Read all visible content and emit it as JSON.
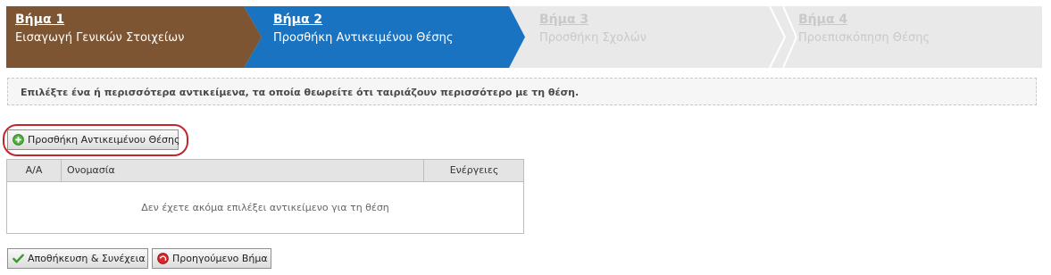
{
  "wizard": {
    "steps": [
      {
        "title": "Βήμα 1",
        "subtitle": "Εισαγωγή Γενικών Στοιχείων",
        "state": "completed",
        "color": "#7d5533"
      },
      {
        "title": "Βήμα 2",
        "subtitle": "Προσθήκη Αντικειμένου Θέσης",
        "state": "active",
        "color": "#1a73c0"
      },
      {
        "title": "Βήμα 3",
        "subtitle": "Προσθήκη Σχολών",
        "state": "disabled",
        "color": "#e9e9e9"
      },
      {
        "title": "Βήμα 4",
        "subtitle": "Προεπισκόπηση Θέσης",
        "state": "disabled",
        "color": "#e9e9e9"
      }
    ]
  },
  "info": {
    "message": "Επιλέξτε ένα ή περισσότερα αντικείμενα, τα οποία θεωρείτε ότι ταιριάζουν περισσότερο με τη θέση."
  },
  "actions": {
    "add_label": "Προσθήκη Αντικειμένου Θέσης",
    "add_icon": "plus-circle-icon",
    "save_label": "Αποθήκευση & Συνέχεια",
    "save_icon": "checkmark-icon",
    "prev_label": "Προηγούμενο Βήμα",
    "prev_icon": "back-arrow-icon"
  },
  "table": {
    "columns": [
      "Α/Α",
      "Ονομασία",
      "Ενέργειες"
    ],
    "empty_message": "Δεν έχετε ακόμα επιλέξει αντικείμενο για τη θέση"
  },
  "colors": {
    "highlight": "#c0272d"
  }
}
